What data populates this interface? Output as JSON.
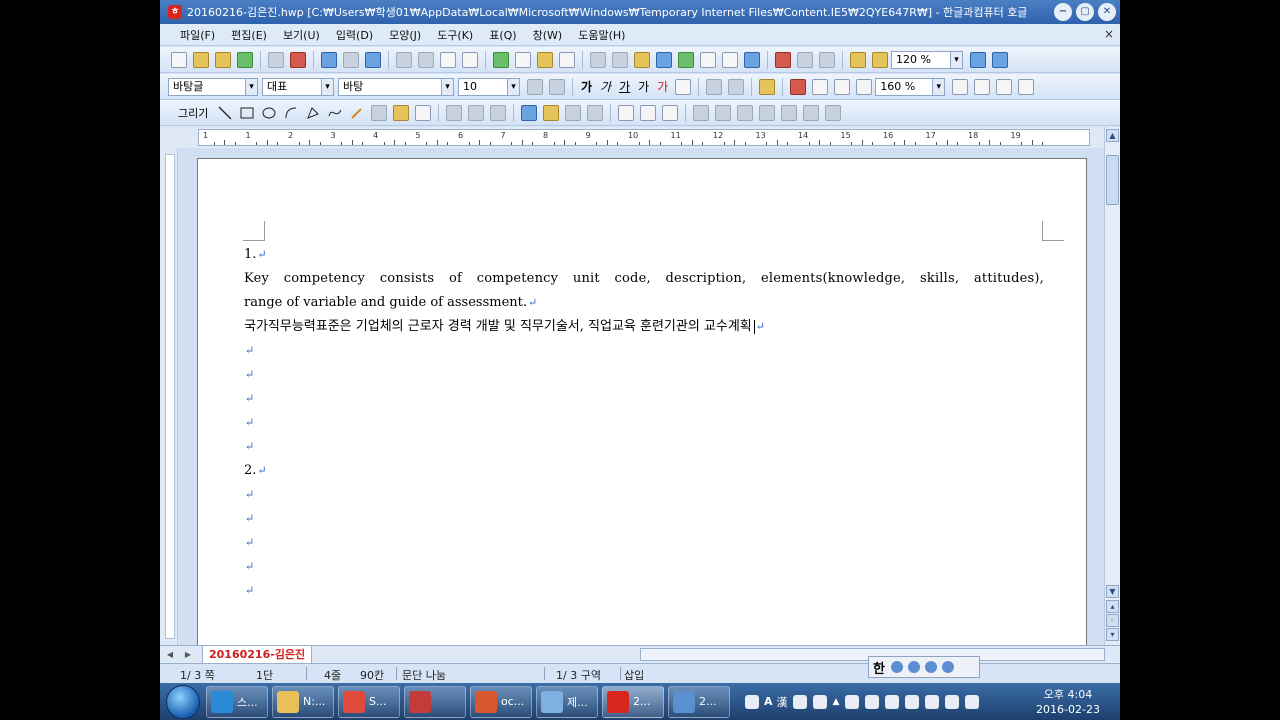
{
  "window": {
    "title": "20160216-김은진.hwp [C:₩Users₩학생01₩AppData₩Local₩Microsoft₩Windows₩Temporary Internet Files₩Content.IE5₩2QYE647R₩] - 한글과컴퓨터 호글",
    "minimize": "−",
    "restore": "▢",
    "close": "✕"
  },
  "menu": {
    "items": [
      "파일(F)",
      "편집(E)",
      "보기(U)",
      "입력(D)",
      "모양(J)",
      "도구(K)",
      "표(Q)",
      "창(W)",
      "도움말(H)"
    ],
    "doc_close": "×"
  },
  "toolbar1": {
    "zoom": "120 %"
  },
  "toolbar2": {
    "style": "바탕글",
    "lang": "대표",
    "font": "바탕",
    "size": "10",
    "bold": "가",
    "italic": "가",
    "underline": "가",
    "strike": "가",
    "color": "가",
    "line_spacing": "160 %"
  },
  "toolbar3": {
    "draw_label": "그리기"
  },
  "ruler_numbers": [
    "1",
    "1",
    "2",
    "3",
    "4",
    "5",
    "6",
    "7",
    "8",
    "9",
    "10",
    "11",
    "12",
    "13",
    "14",
    "15",
    "16",
    "17",
    "18",
    "19"
  ],
  "document": {
    "lines": [
      "1.",
      "Key competency consists of competency unit code, description, elements(knowledge, skills, attitudes),",
      "range of variable and guide of assessment.",
      "국가직무능력표준은 기업체의 근로자 경력 개발 및 직무기술서, 직업교육 훈련기관의 교수계획",
      "",
      "",
      "",
      "",
      "",
      "2.",
      "",
      "",
      "",
      "",
      ""
    ],
    "return_mark": "↵"
  },
  "tab": {
    "name": "20160216-김은진"
  },
  "status": {
    "page": "1/ 3 쪽",
    "column": "1단",
    "line": "4줄",
    "col": "90칸",
    "break": "문단 나눔",
    "section": "1/ 3 구역",
    "mode": "삽입"
  },
  "ime": {
    "han": "한"
  },
  "taskbar": {
    "items": [
      {
        "label": "스...",
        "color": "#2a8ad8"
      },
      {
        "label": "N:...",
        "color": "#e8c05a"
      },
      {
        "label": "S...",
        "color": "#e04a3a"
      },
      {
        "label": "",
        "color": "#c43b3b"
      },
      {
        "label": "oc...",
        "color": "#d9572f"
      },
      {
        "label": "제...",
        "color": "#7fb0e0"
      },
      {
        "label": "2...",
        "color": "#d9261c"
      },
      {
        "label": "2...",
        "color": "#5a8fd0"
      }
    ],
    "time": "오후 4:04",
    "date": "2016-02-23"
  }
}
